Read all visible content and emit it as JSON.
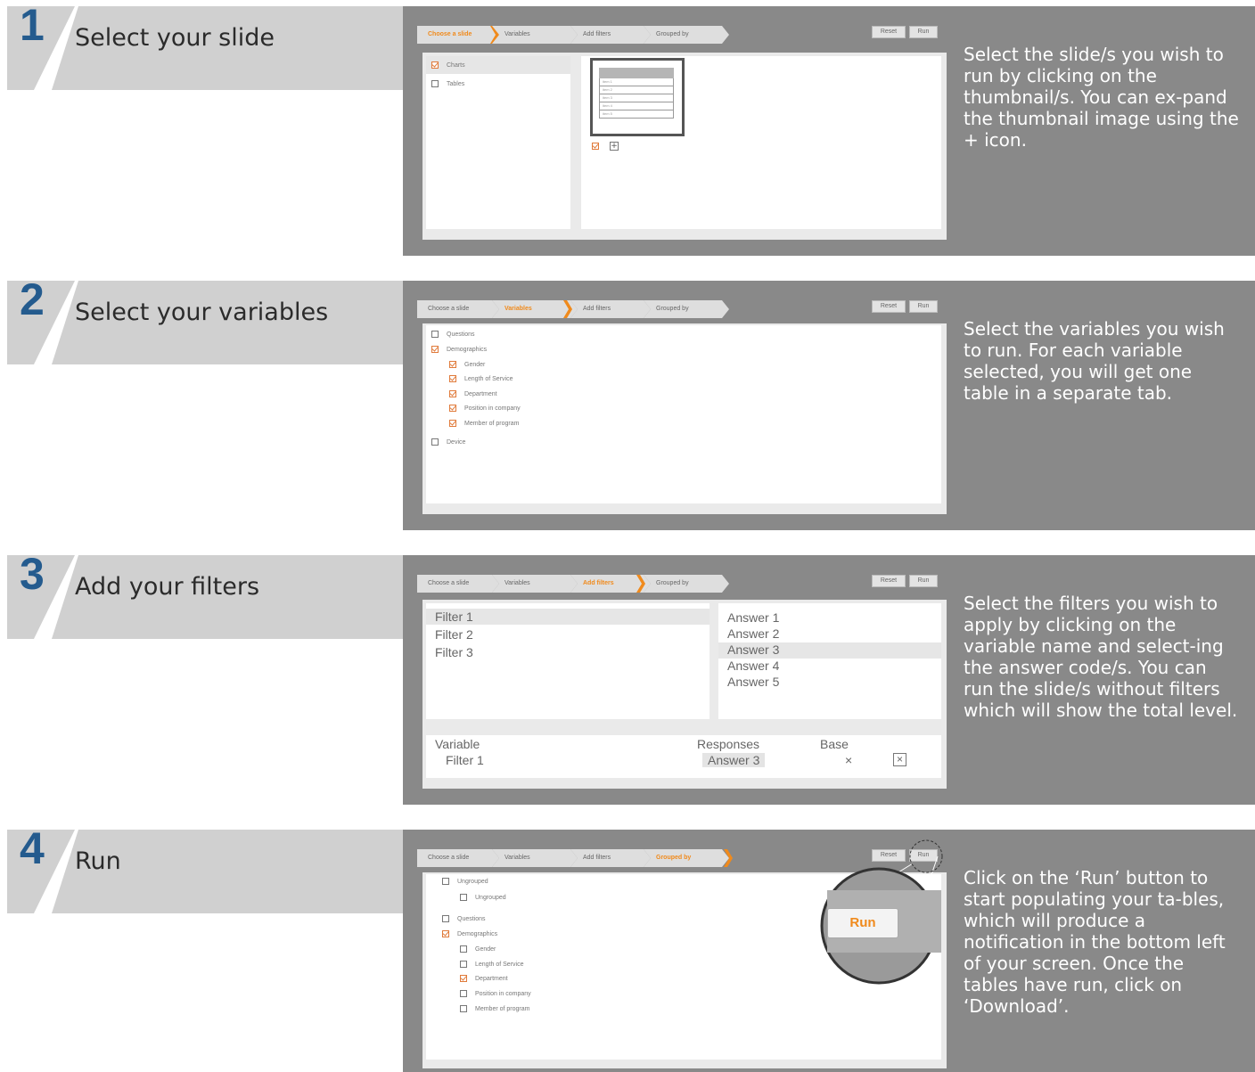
{
  "tabs": [
    "Choose a slide",
    "Variables",
    "Add filters",
    "Grouped by"
  ],
  "buttons": {
    "reset": "Reset",
    "run": "Run",
    "run_zoom": "Run"
  },
  "steps": [
    {
      "number": "1",
      "title": "Select your slide",
      "description": "Select the slide/s you wish to run by clicking on the thumbnail/s. You can ex-pand the thumbnail image using the + icon.",
      "active_tab": 0,
      "slide_types": [
        {
          "label": "Charts",
          "checked": true
        },
        {
          "label": "Tables",
          "checked": false
        }
      ],
      "thumbnail_items": [
        "item 1",
        "item 2",
        "item 3",
        "item 4",
        "item 5"
      ]
    },
    {
      "number": "2",
      "title": "Select your variables",
      "description": "Select the variables you wish to run. For each variable selected, you will get one table in a separate tab.",
      "active_tab": 1,
      "variables": [
        {
          "label": "Questions",
          "checked": false,
          "level": 0
        },
        {
          "label": "Demographics",
          "checked": true,
          "level": 0
        },
        {
          "label": "Gender",
          "checked": true,
          "level": 1
        },
        {
          "label": "Length of Service",
          "checked": true,
          "level": 1
        },
        {
          "label": "Department",
          "checked": true,
          "level": 1
        },
        {
          "label": "Position in company",
          "checked": true,
          "level": 1
        },
        {
          "label": "Member of program",
          "checked": true,
          "level": 1
        },
        {
          "label": "Device",
          "checked": false,
          "level": 0
        }
      ]
    },
    {
      "number": "3",
      "title": "Add your filters",
      "description": "Select the filters you wish to apply by clicking on the variable name and select-ing the answer code/s. You can run the slide/s without filters which will show the total level.",
      "active_tab": 2,
      "filters": [
        "Filter 1",
        "Filter 2",
        "Filter 3"
      ],
      "answers": [
        "Answer 1",
        "Answer 2",
        "Answer 3",
        "Answer 4",
        "Answer 5"
      ],
      "summary_headers": {
        "variable": "Variable",
        "responses": "Responses",
        "base": "Base"
      },
      "summary_row": {
        "variable": "Filter 1",
        "response": "Answer 3",
        "base": "×",
        "remove": "×"
      }
    },
    {
      "number": "4",
      "title": "Run",
      "description": "Click on the ‘Run’ button to start populating your ta-bles, which will produce a notification in the bottom left of your screen. Once the tables have run, click on ‘Download’.",
      "active_tab": 3,
      "groups": [
        {
          "label": "Ungrouped",
          "checked": false,
          "level": 0
        },
        {
          "label": "Ungrouped",
          "checked": false,
          "level": 1
        },
        {
          "label": "Questions",
          "checked": false,
          "level": 0
        },
        {
          "label": "Demographics",
          "checked": true,
          "level": 0
        },
        {
          "label": "Gender",
          "checked": false,
          "level": 1
        },
        {
          "label": "Length of Service",
          "checked": false,
          "level": 1
        },
        {
          "label": "Department",
          "checked": true,
          "level": 1
        },
        {
          "label": "Position in company",
          "checked": false,
          "level": 1
        },
        {
          "label": "Member of program",
          "checked": false,
          "level": 1
        }
      ]
    }
  ],
  "colors": {
    "accent": "#f08a1c",
    "step_number": "#245b8e",
    "panel": "#898989",
    "header": "#d0d0d0"
  }
}
